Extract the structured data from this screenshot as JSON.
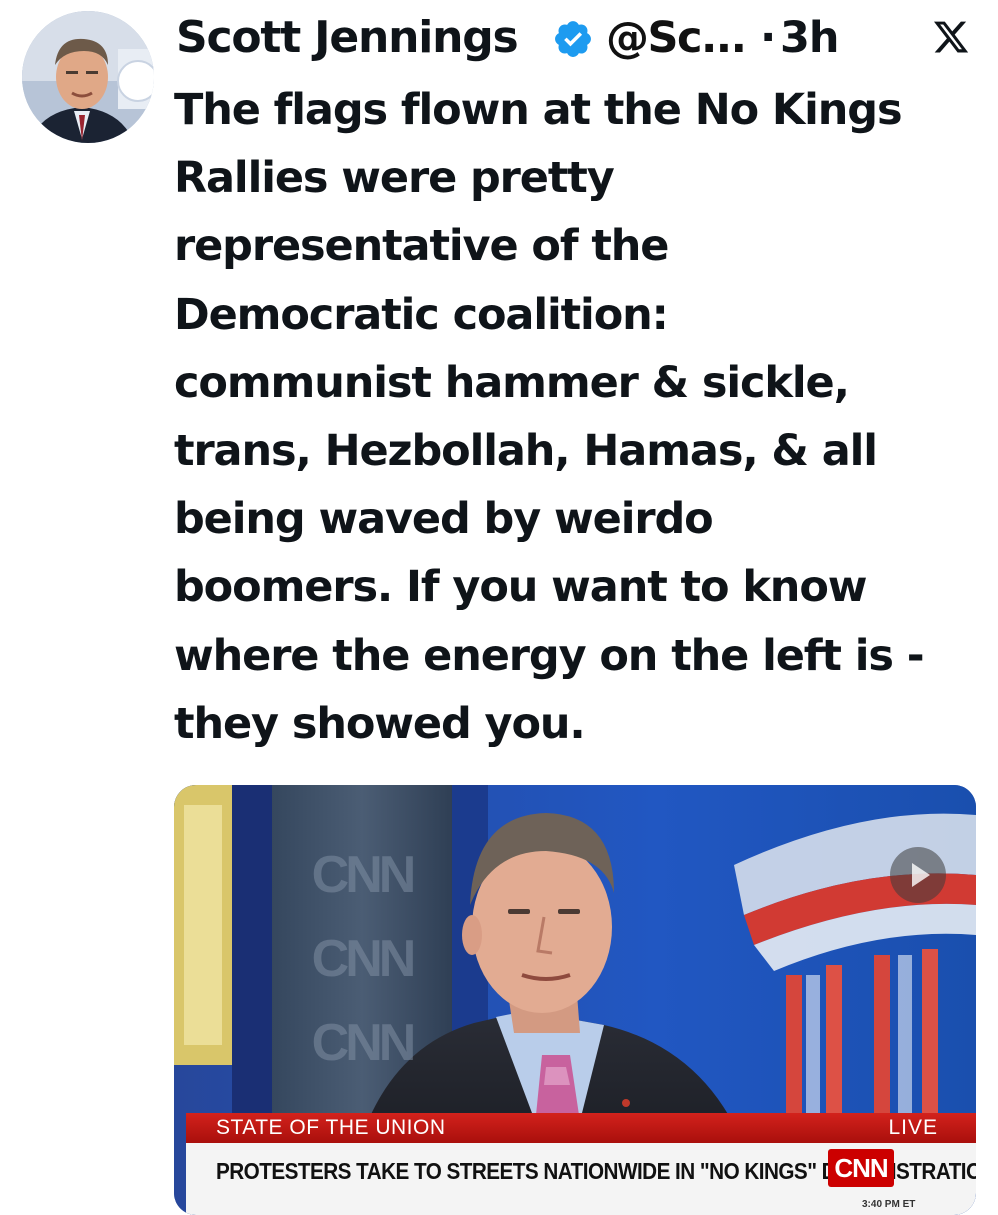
{
  "tweet": {
    "author": {
      "name": "Scott Jennings",
      "handle": "@Sc...",
      "verified": true,
      "avatar_icon": "profile-photo"
    },
    "dot": "·",
    "time": "3h",
    "platform_icon": "x-logo-icon",
    "text": "The flags flown at the No Kings\nRallies were pretty\nrepresentative of the\nDemocratic coalition:\ncommunist hammer & sickle,\ntrans, Hezbollah, Hamas, & all\nbeing waved by weirdo\nboomers. If you want to know\nwhere the energy on the left is -\nthey showed you."
  },
  "media": {
    "type": "video",
    "chyron": {
      "show": "STATE OF THE UNION",
      "live": "LIVE",
      "headline": "PROTESTERS TAKE TO STREETS NATIONWIDE IN \"NO KINGS\" DEMONSTRATIONS",
      "network": "CNN",
      "clock": "3:40 PM ET"
    },
    "background_wall_text": "CNN"
  },
  "colors": {
    "verified": "#1d9bf0",
    "chyron_red": "#c8161d",
    "text": "#0f1419"
  }
}
